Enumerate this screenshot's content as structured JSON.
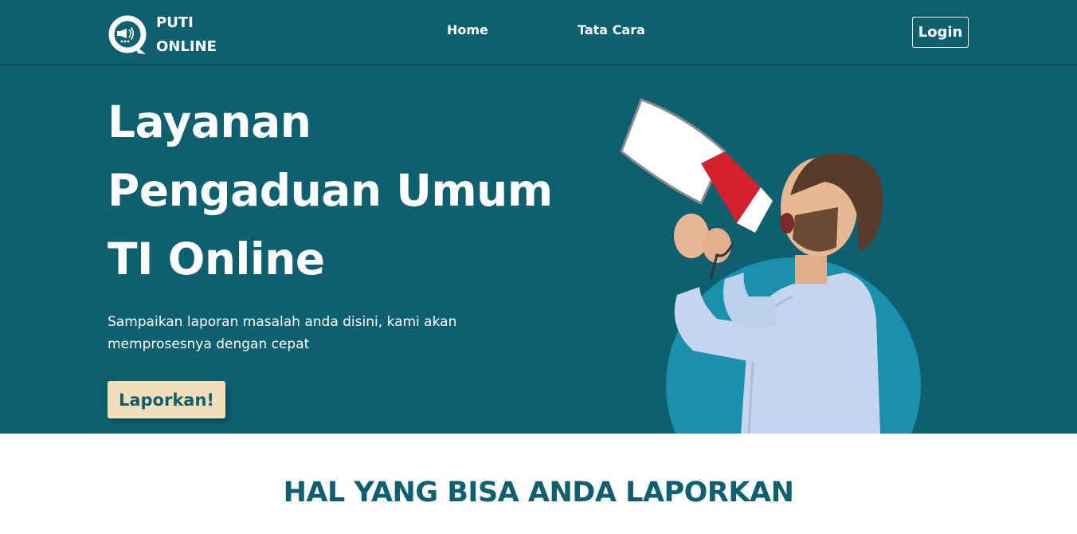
{
  "navbar": {
    "brand_line1": "PUTI",
    "brand_line2": "ONLINE",
    "logo_icon": "megaphone-chat-icon",
    "links": [
      {
        "label": "Home"
      },
      {
        "label": "Tata Cara"
      }
    ],
    "login_label": "Login"
  },
  "hero": {
    "title_lines": [
      "Layanan",
      "Pengaduan Umum",
      "TI Online"
    ],
    "subtitle": "Sampaikan laporan masalah anda disini, kami akan memprosesnya dengan cepat",
    "cta_label": "Laporkan!",
    "illustration": "man-shouting-into-megaphone"
  },
  "section": {
    "heading": "HAL YANG BISA ANDA LAPORKAN"
  },
  "colors": {
    "primary": "#0e5f6f",
    "accent_circle": "#1a8fae",
    "cta_background": "#f2dfba",
    "text_on_primary": "#ffffff"
  }
}
